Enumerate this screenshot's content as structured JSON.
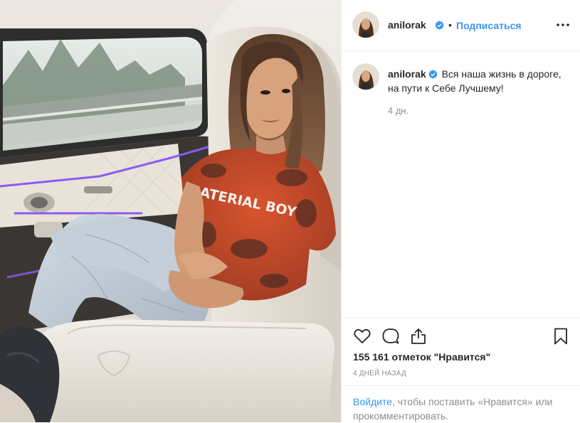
{
  "post": {
    "author": {
      "username": "anilorak",
      "verified": true,
      "avatar_icon": "user-avatar"
    },
    "follow_label": "Подписаться",
    "separator": "•",
    "more_icon": "more-options-icon"
  },
  "caption": {
    "username": "anilorak",
    "text": "Вся наша жизнь в дороге, на пути к Себе Лучшему!",
    "age": "4 дн."
  },
  "photo": {
    "shirt_text": "ATERIAL BOY",
    "colors": {
      "shirt": "#c2482b",
      "jeans": "#b9c4cf",
      "leather": "#e6e0d6",
      "ambient": "#8a5cf2"
    }
  },
  "actions": {
    "icons": [
      "heart-icon",
      "comment-icon",
      "share-icon",
      "bookmark-icon"
    ],
    "likes_count": "155 161",
    "likes_suffix": "отметок \"Нравится\"",
    "date": "4 ДНЕЙ НАЗАД"
  },
  "login_prompt": {
    "link": "Войдите",
    "text": ", чтобы поставить «Нравится» или прокомментировать."
  },
  "colors": {
    "accent": "#3897f0",
    "text": "#262626",
    "muted": "#8e8e8e",
    "border": "#efefef",
    "verified_badge": "#3897f0"
  }
}
